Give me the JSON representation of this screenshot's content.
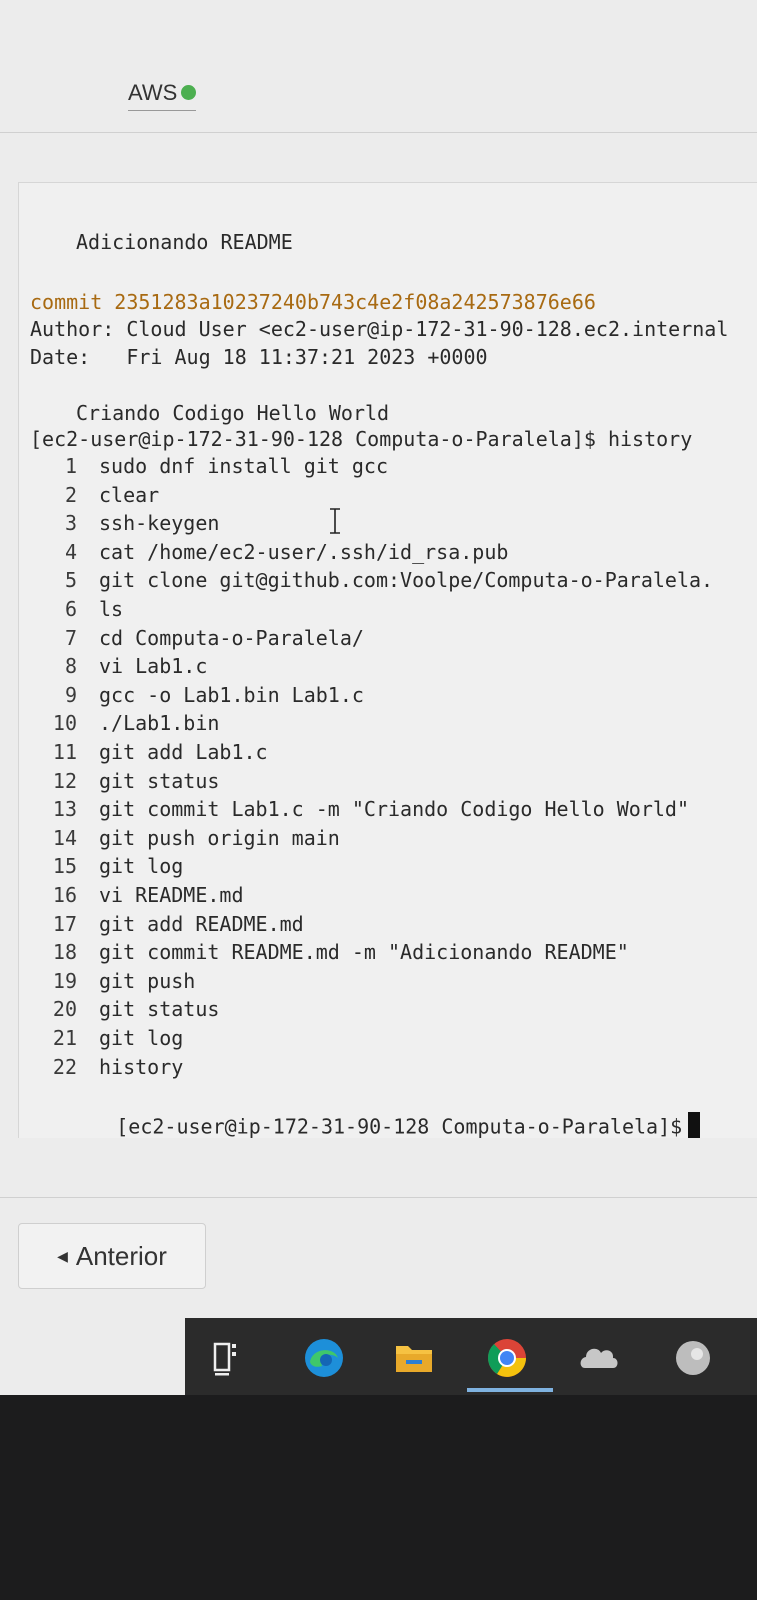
{
  "header": {
    "aws_label": "AWS"
  },
  "terminal": {
    "commit_message": "Adicionando README",
    "commit_line": "commit 2351283a10237240b743c4e2f08a242573876e66",
    "author_line": "Author: Cloud User <ec2-user@ip-172-31-90-128.ec2.internal",
    "date_line": "Date:   Fri Aug 18 11:37:21 2023 +0000",
    "prev_commit_message": "Criando Codigo Hello World",
    "prompt_history": "[ec2-user@ip-172-31-90-128 Computa-o-Paralela]$ history",
    "history": [
      {
        "n": "1",
        "cmd": "sudo dnf install git gcc"
      },
      {
        "n": "2",
        "cmd": "clear"
      },
      {
        "n": "3",
        "cmd": "ssh-keygen"
      },
      {
        "n": "4",
        "cmd": "cat /home/ec2-user/.ssh/id_rsa.pub"
      },
      {
        "n": "5",
        "cmd": "git clone git@github.com:Voolpe/Computa-o-Paralela."
      },
      {
        "n": "6",
        "cmd": "ls"
      },
      {
        "n": "7",
        "cmd": "cd Computa-o-Paralela/"
      },
      {
        "n": "8",
        "cmd": "vi Lab1.c"
      },
      {
        "n": "9",
        "cmd": "gcc -o Lab1.bin Lab1.c"
      },
      {
        "n": "10",
        "cmd": "./Lab1.bin"
      },
      {
        "n": "11",
        "cmd": "git add Lab1.c"
      },
      {
        "n": "12",
        "cmd": "git status"
      },
      {
        "n": "13",
        "cmd": "git commit Lab1.c -m \"Criando Codigo Hello World\""
      },
      {
        "n": "14",
        "cmd": "git push origin main"
      },
      {
        "n": "15",
        "cmd": "git log"
      },
      {
        "n": "16",
        "cmd": "vi README.md"
      },
      {
        "n": "17",
        "cmd": "git add README.md"
      },
      {
        "n": "18",
        "cmd": "git commit README.md -m \"Adicionando README\""
      },
      {
        "n": "19",
        "cmd": "git push"
      },
      {
        "n": "20",
        "cmd": "git status"
      },
      {
        "n": "21",
        "cmd": "git log"
      },
      {
        "n": "22",
        "cmd": "history"
      }
    ],
    "final_prompt": "[ec2-user@ip-172-31-90-128 Computa-o-Paralela]$"
  },
  "navigation": {
    "previous_label": "Anterior"
  },
  "taskbar": {
    "icons": [
      "task-view-icon",
      "edge-icon",
      "file-explorer-icon",
      "chrome-icon",
      "cloud-app-icon",
      "app-icon"
    ],
    "active": "chrome-icon"
  },
  "colors": {
    "status_dot": "#4caf50",
    "commit_hash": "#a86a12"
  }
}
